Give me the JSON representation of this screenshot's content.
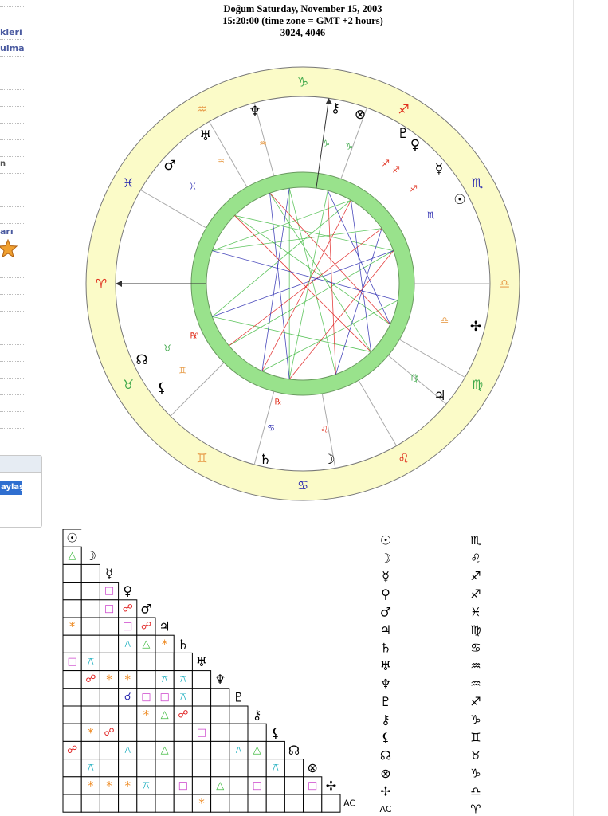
{
  "header": {
    "line1": "Doğum Saturday, November 15, 2003",
    "line2": "15:20:00 (time zone = GMT +2 hours)",
    "line3": "3024, 4046"
  },
  "sidebar": {
    "fragments": [
      "kleri",
      "ulma",
      "n",
      "arı"
    ],
    "share_label": "aylaş",
    "star_icon": "star-icon"
  },
  "colors": {
    "zodiac_ring": "#fbfbc8",
    "aspect_ring": "#99e28c",
    "fire": "#e0301e",
    "earth": "#3ea84a",
    "air": "#e8a050",
    "water": "#2c2cb0",
    "planet": "#000000",
    "sextile": "#ee8a22",
    "square": "#cc44cc",
    "trine": "#44bb44",
    "opposition": "#e02020",
    "conjunction": "#2a2ab0",
    "quincunx": "#22b0c0"
  },
  "wheel": {
    "zodiac_signs": [
      {
        "glyph": "♈",
        "element": "fire"
      },
      {
        "glyph": "♉",
        "element": "earth"
      },
      {
        "glyph": "♊",
        "element": "air"
      },
      {
        "glyph": "♋",
        "element": "water"
      },
      {
        "glyph": "♌",
        "element": "fire"
      },
      {
        "glyph": "♍",
        "element": "earth"
      },
      {
        "glyph": "♎",
        "element": "air"
      },
      {
        "glyph": "♏",
        "element": "water"
      },
      {
        "glyph": "♐",
        "element": "fire"
      },
      {
        "glyph": "♑",
        "element": "earth"
      },
      {
        "glyph": "♒",
        "element": "air"
      },
      {
        "glyph": "♓",
        "element": "water"
      }
    ],
    "house_cusp_signs": [
      {
        "glyph": "♓",
        "element": "water"
      },
      {
        "glyph": "♒",
        "element": "air"
      },
      {
        "glyph": "♒",
        "element": "air"
      },
      {
        "glyph": "♑",
        "element": "earth"
      },
      {
        "glyph": "♑",
        "element": "earth"
      },
      {
        "glyph": "♐",
        "element": "fire"
      },
      {
        "glyph": "♐",
        "element": "fire"
      },
      {
        "glyph": "♐",
        "element": "fire"
      },
      {
        "glyph": "♏",
        "element": "water"
      },
      {
        "glyph": "♎",
        "element": "air"
      },
      {
        "glyph": "♍",
        "element": "earth"
      },
      {
        "glyph": "♌",
        "element": "fire"
      },
      {
        "glyph": "♋",
        "element": "water"
      },
      {
        "glyph": "♊",
        "element": "air"
      },
      {
        "glyph": "♉",
        "element": "earth"
      },
      {
        "glyph": "♈",
        "element": "fire"
      }
    ],
    "planet_glyphs": [
      {
        "name": "neptune",
        "glyph": "♆"
      },
      {
        "name": "chiron",
        "glyph": "⚷"
      },
      {
        "name": "part-of-fortune",
        "glyph": "⊗"
      },
      {
        "name": "uranus",
        "glyph": "♅"
      },
      {
        "name": "pluto",
        "glyph": "♇"
      },
      {
        "name": "venus",
        "glyph": "♀"
      },
      {
        "name": "mercury",
        "glyph": "☿"
      },
      {
        "name": "mars",
        "glyph": "♂"
      },
      {
        "name": "sun",
        "glyph": "☉"
      },
      {
        "name": "vertex",
        "glyph": "✢"
      },
      {
        "name": "jupiter",
        "glyph": "♃"
      },
      {
        "name": "north-node",
        "glyph": "☊"
      },
      {
        "name": "lilith",
        "glyph": "⚸"
      },
      {
        "name": "saturn",
        "glyph": "♄"
      },
      {
        "name": "moon",
        "glyph": "☽"
      }
    ],
    "retro_mark": "℞"
  },
  "aspect_grid": {
    "labels": [
      "☉",
      "☽",
      "☿",
      "♀",
      "♂",
      "♃",
      "♄",
      "♅",
      "♆",
      "♇",
      "⚷",
      "⚸",
      "☊",
      "⊗",
      "✢",
      "AC"
    ],
    "cells": [
      [
        1,
        0,
        "trine"
      ],
      [
        3,
        2,
        "square"
      ],
      [
        4,
        2,
        "square"
      ],
      [
        4,
        3,
        "opposition"
      ],
      [
        5,
        0,
        "sextile"
      ],
      [
        5,
        3,
        "square"
      ],
      [
        5,
        4,
        "opposition"
      ],
      [
        6,
        3,
        "quincunx"
      ],
      [
        6,
        4,
        "trine"
      ],
      [
        6,
        5,
        "sextile"
      ],
      [
        7,
        0,
        "square"
      ],
      [
        7,
        1,
        "quincunx"
      ],
      [
        8,
        1,
        "opposition"
      ],
      [
        8,
        2,
        "sextile"
      ],
      [
        8,
        3,
        "sextile"
      ],
      [
        8,
        5,
        "quincunx"
      ],
      [
        8,
        6,
        "quincunx"
      ],
      [
        9,
        3,
        "conjunction"
      ],
      [
        9,
        4,
        "square"
      ],
      [
        9,
        5,
        "square"
      ],
      [
        9,
        6,
        "quincunx"
      ],
      [
        10,
        4,
        "sextile"
      ],
      [
        10,
        5,
        "trine"
      ],
      [
        10,
        6,
        "opposition"
      ],
      [
        11,
        1,
        "sextile"
      ],
      [
        11,
        2,
        "opposition"
      ],
      [
        11,
        7,
        "square"
      ],
      [
        12,
        0,
        "opposition"
      ],
      [
        12,
        3,
        "quincunx"
      ],
      [
        12,
        5,
        "trine"
      ],
      [
        12,
        9,
        "quincunx"
      ],
      [
        12,
        10,
        "trine"
      ],
      [
        13,
        1,
        "quincunx"
      ],
      [
        13,
        11,
        "quincunx"
      ],
      [
        14,
        1,
        "sextile"
      ],
      [
        14,
        2,
        "sextile"
      ],
      [
        14,
        3,
        "sextile"
      ],
      [
        14,
        4,
        "quincunx"
      ],
      [
        14,
        6,
        "square"
      ],
      [
        14,
        8,
        "trine"
      ],
      [
        14,
        10,
        "square"
      ],
      [
        14,
        13,
        "square"
      ],
      [
        15,
        7,
        "sextile"
      ]
    ]
  },
  "placements": [
    {
      "planet": "☉",
      "sign": "♏"
    },
    {
      "planet": "☽",
      "sign": "♌"
    },
    {
      "planet": "☿",
      "sign": "♐"
    },
    {
      "planet": "♀",
      "sign": "♐"
    },
    {
      "planet": "♂",
      "sign": "♓"
    },
    {
      "planet": "♃",
      "sign": "♍"
    },
    {
      "planet": "♄",
      "sign": "♋"
    },
    {
      "planet": "♅",
      "sign": "♒"
    },
    {
      "planet": "♆",
      "sign": "♒"
    },
    {
      "planet": "♇",
      "sign": "♐"
    },
    {
      "planet": "⚷",
      "sign": "♑"
    },
    {
      "planet": "⚸",
      "sign": "♊"
    },
    {
      "planet": "☊",
      "sign": "♉"
    },
    {
      "planet": "⊗",
      "sign": "♑"
    },
    {
      "planet": "✢",
      "sign": "♎"
    },
    {
      "planet": "AC",
      "sign": "♈"
    }
  ]
}
